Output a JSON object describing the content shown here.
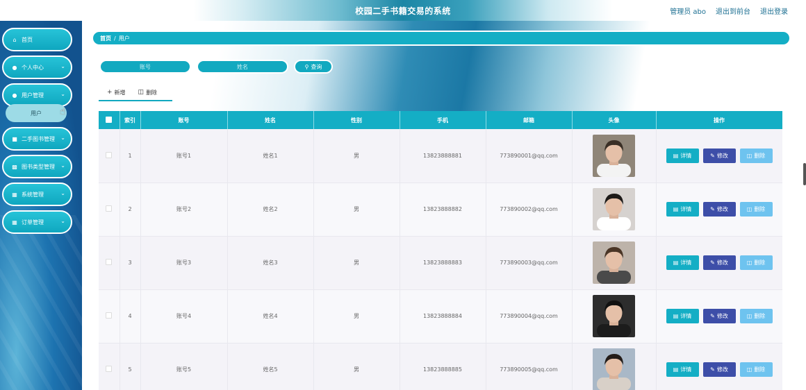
{
  "header": {
    "app_title": "校园二手书籍交易的系统",
    "user_label": "管理员 abo",
    "to_front_label": "退出到前台",
    "logout_label": "退出登录"
  },
  "sidebar": {
    "items": [
      {
        "label": "首页",
        "icon": "home-icon"
      },
      {
        "label": "个人中心",
        "icon": "user-icon"
      },
      {
        "label": "用户管理",
        "icon": "user-icon"
      },
      {
        "label": "二手图书管理",
        "icon": "book-icon"
      },
      {
        "label": "图书类型管理",
        "icon": "chart-icon"
      },
      {
        "label": "系统管理",
        "icon": "grid-icon"
      },
      {
        "label": "订单管理",
        "icon": "grid-icon"
      }
    ],
    "sub_item": {
      "label": "用户"
    }
  },
  "breadcrumb": {
    "home": "首页",
    "separator": "/",
    "current": "用户"
  },
  "search": {
    "account_placeholder": "账号",
    "name_placeholder": "姓名",
    "query_label": "查询"
  },
  "actions": {
    "add_label": "新增",
    "delete_label": "删除"
  },
  "table": {
    "headers": [
      "索引",
      "账号",
      "姓名",
      "性别",
      "手机",
      "邮箱",
      "头像",
      "操作"
    ],
    "rows": [
      {
        "index": "1",
        "account": "账号1",
        "name": "姓名1",
        "gender": "男",
        "phone": "13823888881",
        "email": "773890001@qq.com"
      },
      {
        "index": "2",
        "account": "账号2",
        "name": "姓名2",
        "gender": "男",
        "phone": "13823888882",
        "email": "773890002@qq.com"
      },
      {
        "index": "3",
        "account": "账号3",
        "name": "姓名3",
        "gender": "男",
        "phone": "13823888883",
        "email": "773890003@qq.com"
      },
      {
        "index": "4",
        "account": "账号4",
        "name": "姓名4",
        "gender": "男",
        "phone": "13823888884",
        "email": "773890004@qq.com"
      },
      {
        "index": "5",
        "account": "账号5",
        "name": "姓名5",
        "gender": "男",
        "phone": "13823888885",
        "email": "773890005@qq.com"
      }
    ],
    "op_labels": {
      "detail": "详情",
      "edit": "修改",
      "delete": "删除"
    }
  },
  "colors": {
    "accent": "#14aec5",
    "edit": "#3d4ea8",
    "delete": "#6ec3ef"
  }
}
